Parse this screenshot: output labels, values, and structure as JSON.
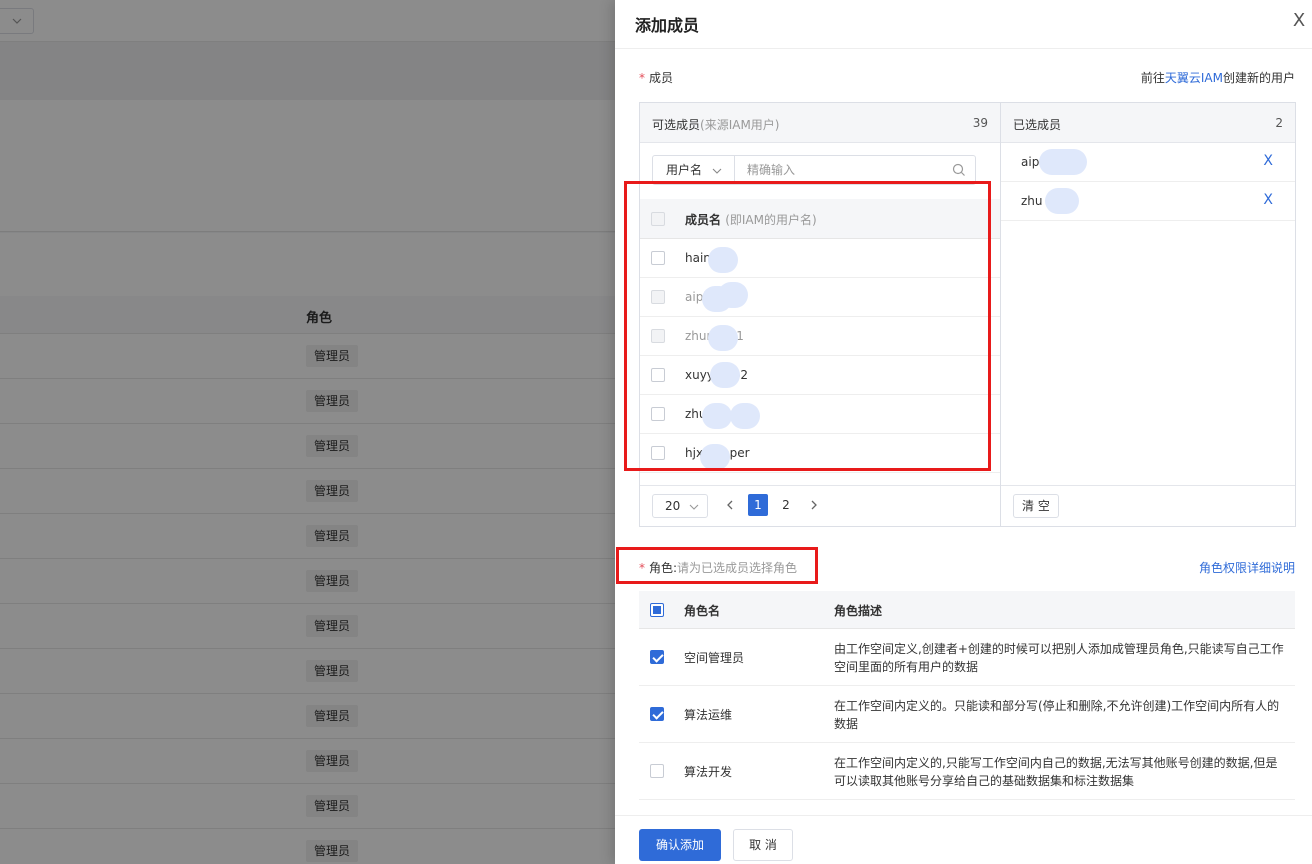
{
  "background": {
    "column_header": "角色",
    "rows": [
      "管理员",
      "管理员",
      "管理员",
      "管理员",
      "管理员",
      "管理员",
      "管理员",
      "管理员",
      "管理员",
      "管理员",
      "管理员",
      "管理员"
    ]
  },
  "drawer": {
    "title": "添加成员",
    "close": "X",
    "required_mark": "*",
    "member_label": "成员",
    "iam_prefix": "前往",
    "iam_link": "天翼云IAM",
    "iam_suffix": "创建新的用户",
    "available": {
      "title": "可选成员",
      "subtitle": "(来源IAM用户)",
      "count": "39",
      "search_field": "用户名",
      "search_placeholder": "精确输入",
      "col_name": "成员名",
      "col_sub": "(即IAM的用户名)",
      "rows": [
        {
          "name": "haim  hu",
          "disabled": false
        },
        {
          "name": "aipl   v",
          "disabled": true
        },
        {
          "name": "zhun   hai1",
          "disabled": true
        },
        {
          "name": "xuyy2  ab2",
          "disabled": false
        },
        {
          "name": "zhu   g",
          "disabled": false
        },
        {
          "name": "hjx  reloper",
          "disabled": false
        }
      ],
      "page_size": "20",
      "pages": [
        "1",
        "2"
      ],
      "current_page": "1"
    },
    "selected": {
      "title": "已选成员",
      "count": "2",
      "rows": [
        {
          "name": "aip"
        },
        {
          "name": "zhu    ai1"
        }
      ],
      "remove": "X",
      "clear": "清 空"
    },
    "role": {
      "label": "角色:",
      "placeholder": "请为已选成员选择角色",
      "help_link": "角色权限详细说明",
      "col_name": "角色名",
      "col_desc": "角色描述",
      "rows": [
        {
          "name": "空间管理员",
          "checked": true,
          "desc": "由工作空间定义,创建者+创建的时候可以把别人添加成管理员角色,只能读写自己工作空间里面的所有用户的数据"
        },
        {
          "name": "算法运维",
          "checked": true,
          "desc": "在工作空间内定义的。只能读和部分写(停止和删除,不允许创建)工作空间内所有人的数据"
        },
        {
          "name": "算法开发",
          "checked": false,
          "desc": "在工作空间内定义的,只能写工作空间内自己的数据,无法写其他账号创建的数据,但是可以读取其他账号分享给自己的基础数据集和标注数据集"
        }
      ]
    },
    "footer": {
      "confirm": "确认添加",
      "cancel": "取 消"
    }
  }
}
